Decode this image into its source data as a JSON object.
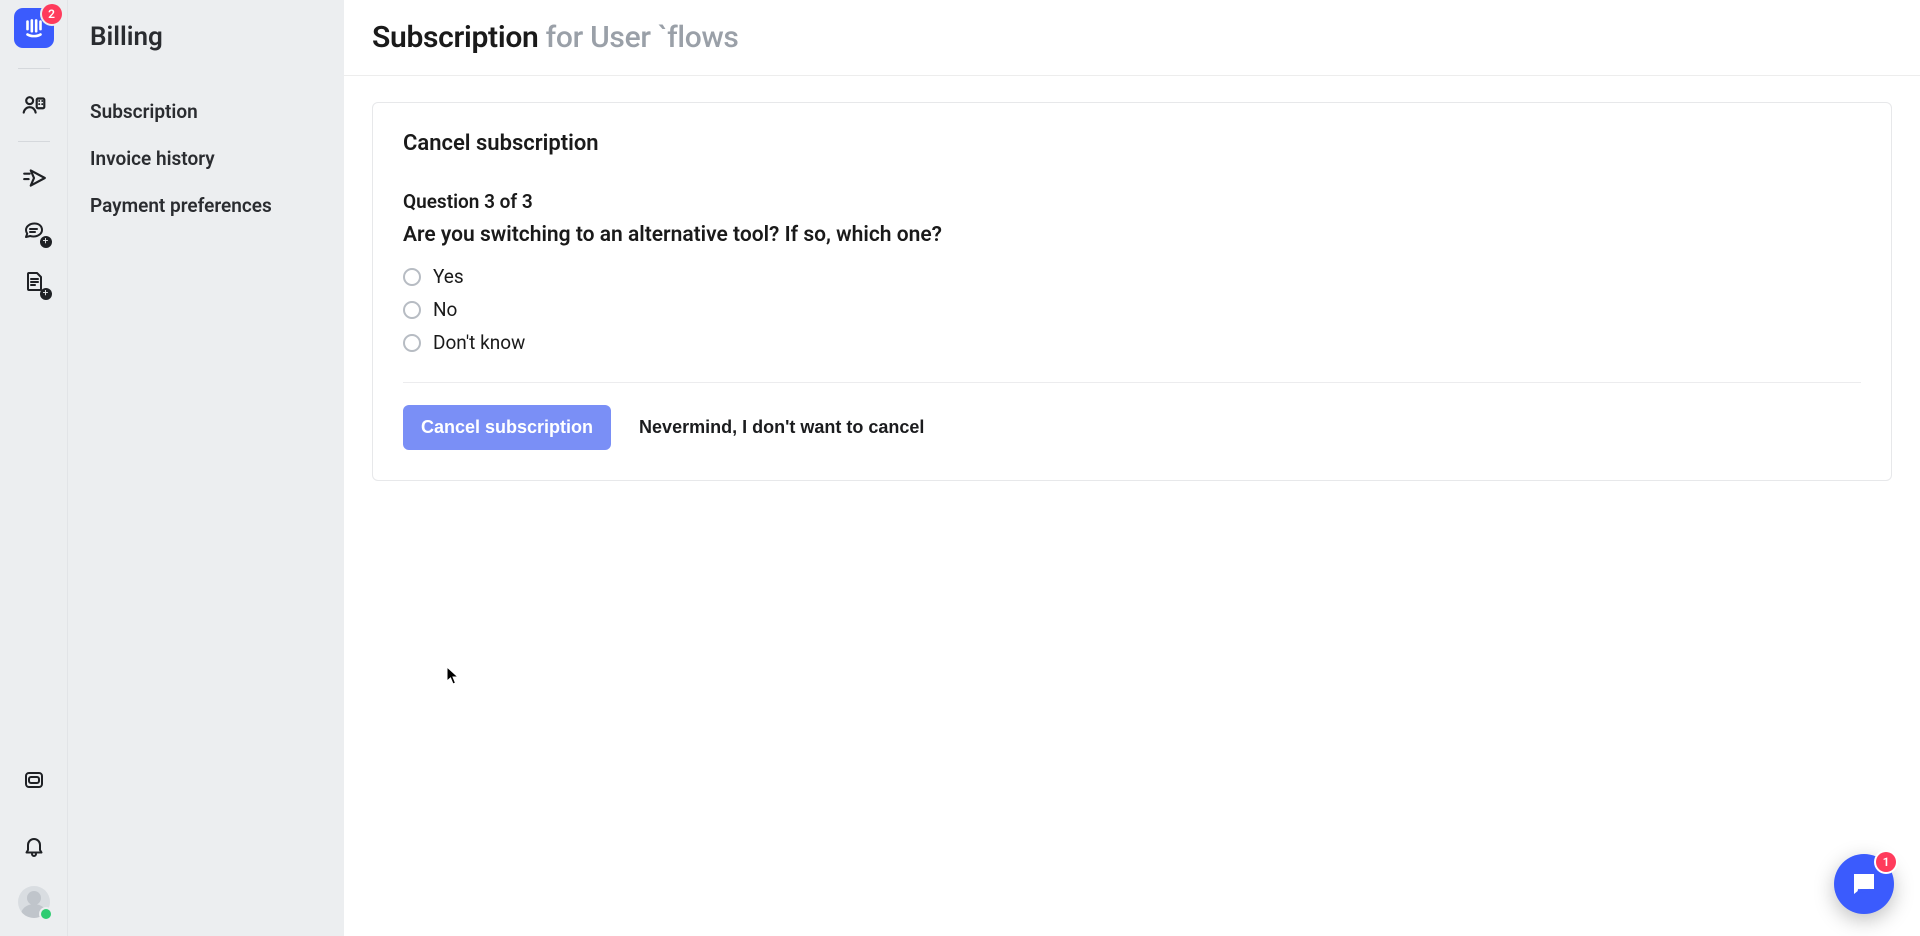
{
  "iconRail": {
    "logoBadge": "2"
  },
  "sidebar": {
    "title": "Billing",
    "items": [
      {
        "label": "Subscription"
      },
      {
        "label": "Invoice history"
      },
      {
        "label": "Payment preferences"
      }
    ]
  },
  "header": {
    "titleStrong": "Subscription",
    "titleMuted": " for User `flows"
  },
  "card": {
    "title": "Cancel subscription",
    "questionLabel": "Question 3 of 3",
    "questionText": "Are you switching to an alternative tool? If so, which one?",
    "options": [
      {
        "label": "Yes"
      },
      {
        "label": "No"
      },
      {
        "label": "Don't know"
      }
    ],
    "primaryCta": "Cancel subscription",
    "secondaryCta": "Nevermind, I don't want to cancel"
  },
  "chat": {
    "badge": "1"
  }
}
